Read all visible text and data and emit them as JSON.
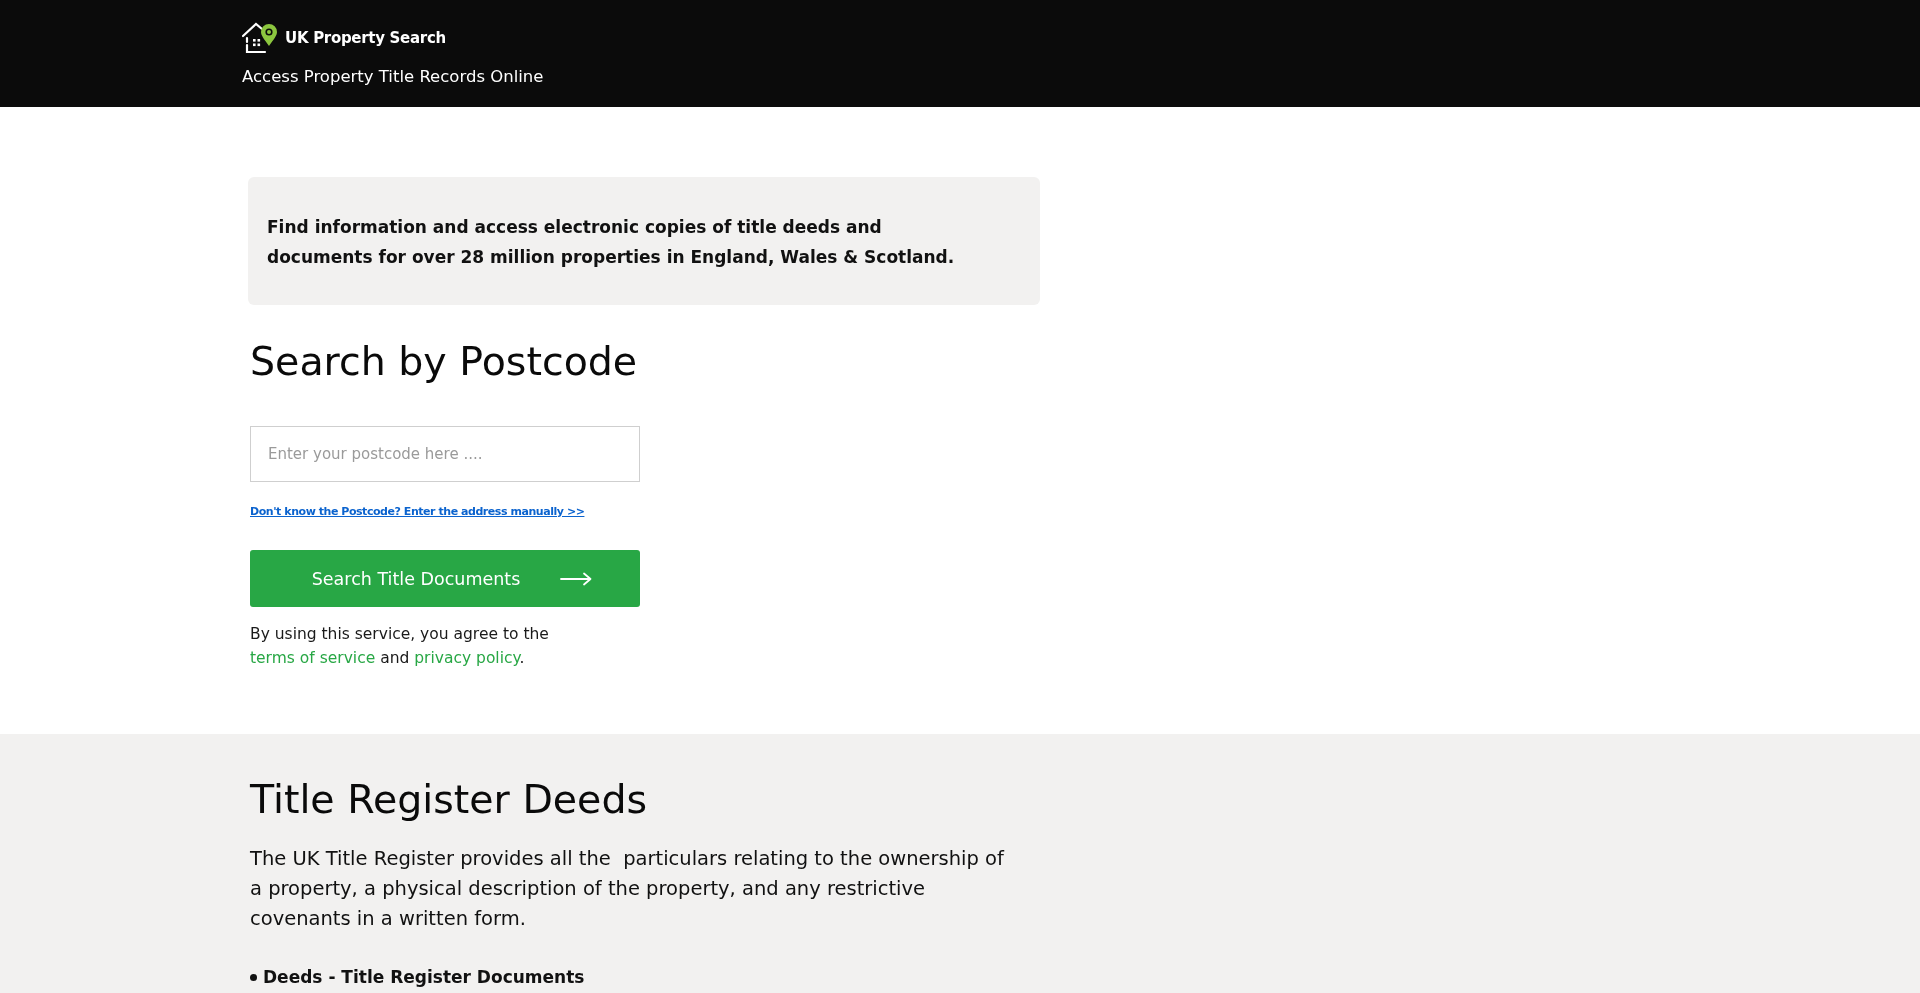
{
  "header": {
    "logo_text": "UK Property Search",
    "tagline": "Access Property Title Records Online"
  },
  "intro": {
    "text": "Find information and access electronic copies of title deeds and documents for over 28 million properties in England, Wales & Scotland."
  },
  "search": {
    "heading": "Search by Postcode",
    "postcode_field": {
      "placeholder": "Enter your postcode here ...."
    },
    "manual_link": "Don't know the Postcode? Enter the address manually >>",
    "button": "Search Title Documents",
    "terms": [
      {
        "kind": "text",
        "text": "By using this service, you agree to the "
      },
      {
        "kind": "link",
        "text": "terms of service"
      },
      {
        "kind": "text",
        "text": " and "
      },
      {
        "kind": "link",
        "text": "privacy policy"
      },
      {
        "kind": "text",
        "text": "."
      }
    ]
  },
  "title_register": {
    "heading": "Title Register Deeds",
    "text": "The UK Title Register provides all the  particulars relating to the ownership of a property, a physical description of the property, and any restrictive covenants in a written form.",
    "bullets": [
      "Deeds - Title Register Documents"
    ]
  }
}
